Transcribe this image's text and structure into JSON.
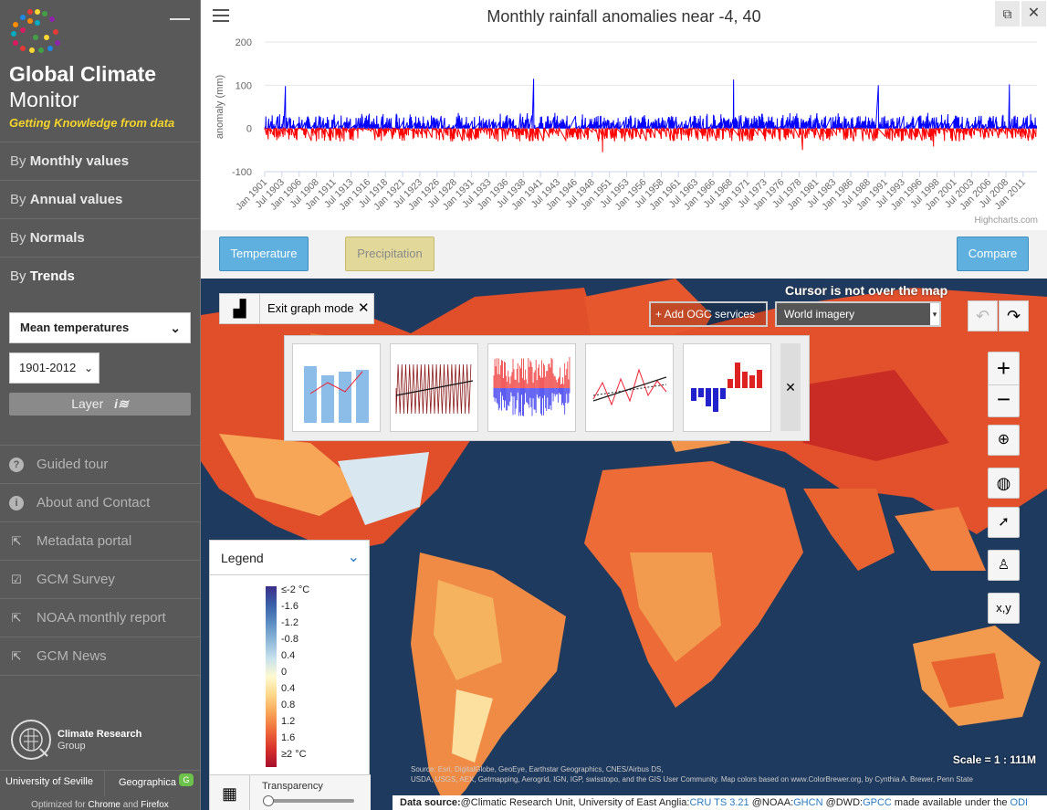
{
  "sidebar": {
    "title": "Global Climate",
    "subtitle": "Monitor",
    "tagline": "Getting Knowledge from data",
    "nav": [
      {
        "prefix": "By ",
        "label": "Monthly values"
      },
      {
        "prefix": "By ",
        "label": "Annual values"
      },
      {
        "prefix": "By ",
        "label": "Normals"
      },
      {
        "prefix": "By ",
        "label": "Trends"
      }
    ],
    "variable_select": "Mean temperatures",
    "period_select": "1901-2012",
    "layer_button": "Layer",
    "links": [
      {
        "icon": "question-icon",
        "label": "Guided tour"
      },
      {
        "icon": "info-icon",
        "label": "About and Contact"
      },
      {
        "icon": "external-link-icon",
        "label": "Metadata portal"
      },
      {
        "icon": "survey-icon",
        "label": "GCM Survey"
      },
      {
        "icon": "external-link-icon",
        "label": "NOAA monthly report"
      },
      {
        "icon": "external-link-icon",
        "label": "GCM News"
      }
    ],
    "org_name": "Climate Research",
    "org_sub": "Group",
    "footer_left": "University of Seville",
    "footer_right": "Geographica",
    "optimized_prefix": "Optimized for ",
    "optimized_a": "Chrome",
    "optimized_mid": " and ",
    "optimized_b": "Firefox"
  },
  "chart_panel": {
    "credits": "Highcharts.com",
    "buttons": {
      "temperature": "Temperature",
      "precipitation": "Precipitation",
      "compare": "Compare"
    }
  },
  "chart_data": {
    "type": "area",
    "title": "Monthly rainfall anomalies near -4, 40",
    "ylabel": "anomaly (mm)",
    "xlabel": "",
    "ylim": [
      -100,
      200
    ],
    "y_ticks": [
      200,
      100,
      0,
      -100
    ],
    "x_ticks": [
      "Jan 1901",
      "Jul 1903",
      "Jan 1906",
      "Jul 1908",
      "Jan 1911",
      "Jul 1913",
      "Jan 1916",
      "Jul 1918",
      "Jan 1921",
      "Jul 1923",
      "Jan 1926",
      "Jul 1928",
      "Jan 1931",
      "Jul 1933",
      "Jan 1936",
      "Jul 1938",
      "Jan 1941",
      "Jul 1943",
      "Jan 1946",
      "Jul 1948",
      "Jan 1951",
      "Jul 1953",
      "Jan 1956",
      "Jul 1958",
      "Jan 1961",
      "Jul 1963",
      "Jan 1966",
      "Jul 1968",
      "Jan 1971",
      "Jul 1973",
      "Jan 1976",
      "Jul 1978",
      "Jan 1981",
      "Jul 1983",
      "Jan 1986",
      "Jul 1988",
      "Jan 1991",
      "Jul 1993",
      "Jan 1996",
      "Jul 1998",
      "Jan 2001",
      "Jul 2003",
      "Jan 2006",
      "Jul 2008",
      "Jan 2011"
    ],
    "x_range": [
      "Jan 1901",
      "Dec 2012"
    ],
    "series": [
      {
        "color": "#0000ff",
        "peaks": [
          {
            "x": "Jan 1904",
            "y": 98
          },
          {
            "x": "Jan 1940",
            "y": 115
          },
          {
            "x": "Jan 1969",
            "y": 113
          },
          {
            "x": "Jan 1990",
            "y": 100
          },
          {
            "x": "Jan 2009",
            "y": 102
          }
        ]
      },
      {
        "color": "#ff0000",
        "peaks": [
          {
            "x": "Jan 1950",
            "y": -55
          },
          {
            "x": "Jan 1979",
            "y": -50
          },
          {
            "x": "Jan 1998",
            "y": -42
          }
        ]
      }
    ],
    "grid": true
  },
  "map": {
    "exit_graph": "Exit graph mode",
    "ogc_button": "+ Add OGC services",
    "basemap_select": "World imagery",
    "cursor_status": "Cursor is not over the map",
    "legend_title": "Legend",
    "legend_labels": [
      "≤-2 °C",
      "-1.6",
      "-1.2",
      "-0.8",
      "0.4",
      "0",
      "0.4",
      "0.8",
      "1.2",
      "1.6",
      "≥2 °C"
    ],
    "legend_colors": [
      "#3b2f88",
      "#3a5fa8",
      "#5b8cc2",
      "#8eb8d8",
      "#c9e2ee",
      "#fffad0",
      "#fdd88a",
      "#f9a557",
      "#ef6a3a",
      "#d7302a",
      "#a60f2c"
    ],
    "transparency_label": "Transparency",
    "scale_text": "Scale = 1 : 111M",
    "attribution_1": "Source: Esri, DigitalGlobe, GeoEye, Earthstar Geographics, CNES/Airbus DS,",
    "attribution_2": "USDA, USGS, AEX, Getmapping, Aerogrid, IGN, IGP, swisstopo, and the GIS User Community. Map colors based on www.ColorBrewer.org, by Cynthia A. Brewer, Penn State",
    "data_source_prefix": "Data source:",
    "data_source_1": "@Climatic Research Unit, University of East Anglia:",
    "data_source_1_link": "CRU TS 3.21",
    "data_source_2": " @NOAA:",
    "data_source_2_link": "GHCN",
    "data_source_3": " @DWD:",
    "data_source_3_link": "GPCC",
    "data_source_4": " made available under the ",
    "data_source_4_link": "ODI"
  }
}
